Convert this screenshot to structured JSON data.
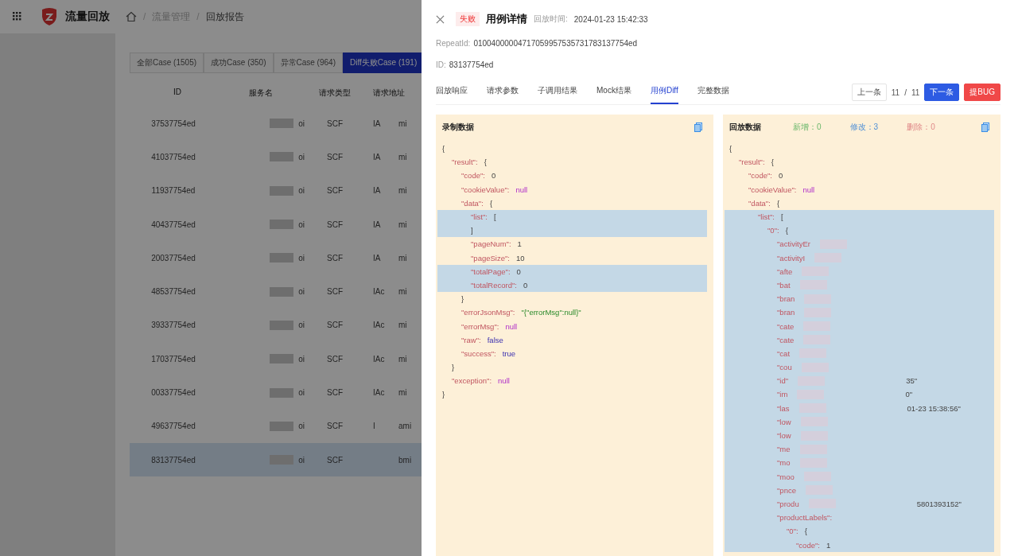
{
  "app": {
    "title": "流量回放",
    "breadcrumb": [
      "流量管理",
      "回放报告"
    ],
    "breadcrumb_separator": "/"
  },
  "case_tabs": [
    {
      "label": "全部Case (1505)",
      "selected": false
    },
    {
      "label": "成功Case (350)",
      "selected": false
    },
    {
      "label": "异常Case (964)",
      "selected": false
    },
    {
      "label": "Diff失败Case (191)",
      "selected": true
    }
  ],
  "table": {
    "columns": [
      "ID",
      "服务名",
      "请求类型",
      "请求地址"
    ],
    "rows": [
      {
        "id": "37537754ed",
        "service": "oi",
        "type": "SCF",
        "address": "IA",
        "column_5": "mi",
        "selected": false
      },
      {
        "id": "41037754ed",
        "service": "oi",
        "type": "SCF",
        "address": "IA",
        "column_5": "mi",
        "selected": false
      },
      {
        "id": "11937754ed",
        "service": "oi",
        "type": "SCF",
        "address": "IA",
        "column_5": "mi",
        "selected": false
      },
      {
        "id": "40437754ed",
        "service": "oi",
        "type": "SCF",
        "address": "IA",
        "column_5": "mi",
        "selected": false
      },
      {
        "id": "20037754ed",
        "service": "oi",
        "type": "SCF",
        "address": "IA",
        "column_5": "mi",
        "selected": false
      },
      {
        "id": "48537754ed",
        "service": "oi",
        "type": "SCF",
        "address": "IAc",
        "column_5": "mi",
        "selected": false
      },
      {
        "id": "39337754ed",
        "service": "oi",
        "type": "SCF",
        "address": "IAc",
        "column_5": "mi",
        "selected": false
      },
      {
        "id": "17037754ed",
        "service": "oi",
        "type": "SCF",
        "address": "IAc",
        "column_5": "mi",
        "selected": false
      },
      {
        "id": "00337754ed",
        "service": "oi",
        "type": "SCF",
        "address": "IAc",
        "column_5": "mi",
        "selected": false
      },
      {
        "id": "49637754ed",
        "service": "oi",
        "type": "SCF",
        "address": "I",
        "column_5": "ami",
        "selected": false
      },
      {
        "id": "83137754ed",
        "service": "oi",
        "type": "SCF",
        "address": "",
        "column_5": "bmi",
        "selected": true
      }
    ]
  },
  "drawer": {
    "status": "失败",
    "title": "用例详情",
    "time_label": "回放时间:",
    "time": "2024-01-23 15:42:33",
    "repeat_label": "RepeatId:",
    "repeat_id": "01004000004717059957535731783137754ed",
    "id_label": "ID:",
    "id": "83137754ed",
    "tabs": [
      {
        "label": "回放响应",
        "selected": false
      },
      {
        "label": "请求参数",
        "selected": false
      },
      {
        "label": "子调用结果",
        "selected": false
      },
      {
        "label": "Mock结果",
        "selected": false
      },
      {
        "label": "用例Diff",
        "selected": true
      },
      {
        "label": "完整数据",
        "selected": false
      }
    ],
    "pager": {
      "prev": "上一条",
      "current": "11",
      "separator": "/",
      "total": "11",
      "next": "下一条",
      "bug": "提BUG"
    },
    "panels": [
      {
        "title": "录制数据",
        "tree": {
          "kind": "object",
          "open": "{",
          "close": "}",
          "children": [
            {
              "key": "\"result\":",
              "kind": "object",
              "open": "{",
              "close": "}",
              "children": [
                {
                  "key": "\"code\":",
                  "kind": "number",
                  "value": "0"
                },
                {
                  "key": "\"cookieValue\":",
                  "kind": "null",
                  "value": "null"
                },
                {
                  "key": "\"data\":",
                  "kind": "object",
                  "open": "{",
                  "close": "}",
                  "children": [
                    {
                      "key": "\"list\":",
                      "kind": "object",
                      "open": "[",
                      "close": "]",
                      "changed": true
                    },
                    {
                      "key": "\"pageNum\":",
                      "kind": "number",
                      "value": "1"
                    },
                    {
                      "key": "\"pageSize\":",
                      "kind": "number",
                      "value": "10"
                    },
                    {
                      "key": "\"totalPage\":",
                      "kind": "number",
                      "value": "0",
                      "changed": true
                    },
                    {
                      "key": "\"totalRecord\":",
                      "kind": "number",
                      "value": "0",
                      "changed": true
                    }
                  ]
                },
                {
                  "key": "\"errorJsonMsg\":",
                  "kind": "string",
                  "value": "\"{\"errorMsg\":null}\""
                },
                {
                  "key": "\"errorMsg\":",
                  "kind": "null",
                  "value": "null"
                },
                {
                  "key": "\"raw\":",
                  "kind": "bool",
                  "value": "false"
                },
                {
                  "key": "\"success\":",
                  "kind": "bool",
                  "value": "true"
                }
              ]
            },
            {
              "key": "\"exception\":",
              "kind": "null",
              "value": "null"
            }
          ]
        }
      },
      {
        "title": "回放数据",
        "stats": [
          {
            "label": "新增：0",
            "kind": "added"
          },
          {
            "label": "修改：3",
            "kind": "modified"
          },
          {
            "label": "删除：0",
            "kind": "deleted"
          }
        ],
        "tree": {
          "kind": "object",
          "open": "{",
          "children": [
            {
              "key": "\"result\":",
              "kind": "object",
              "open": "{",
              "children": [
                {
                  "key": "\"code\":",
                  "kind": "number",
                  "value": "0"
                },
                {
                  "key": "\"cookieValue\":",
                  "kind": "null",
                  "value": "null"
                },
                {
                  "key": "\"data\":",
                  "kind": "object",
                  "open": "{",
                  "children": [
                    {
                      "key": "\"list\":",
                      "kind": "object",
                      "open": "[",
                      "changed": true,
                      "children": [
                        {
                          "key": "\"0\":",
                          "kind": "object",
                          "open": "{",
                          "children": [
                            {
                              "key": "\"activityEr",
                              "kind": "redacted"
                            },
                            {
                              "key": "\"activityI",
                              "kind": "redacted"
                            },
                            {
                              "key": "\"afte",
                              "kind": "redacted"
                            },
                            {
                              "key": "\"bat",
                              "kind": "redacted"
                            },
                            {
                              "key": "\"bran",
                              "kind": "redacted"
                            },
                            {
                              "key": "\"bran",
                              "kind": "redacted"
                            },
                            {
                              "key": "\"cate",
                              "kind": "redacted"
                            },
                            {
                              "key": "\"cate",
                              "kind": "redacted"
                            },
                            {
                              "key": "\"cat",
                              "kind": "redacted"
                            },
                            {
                              "key": "\"cou",
                              "kind": "redacted"
                            },
                            {
                              "key": "\"id\"",
                              "kind": "redacted",
                              "value": "35\""
                            },
                            {
                              "key": "\"im",
                              "kind": "redacted",
                              "value": "0\""
                            },
                            {
                              "key": "\"las",
                              "kind": "redacted",
                              "value": "01-23 15:38:56\""
                            },
                            {
                              "key": "\"low",
                              "kind": "redacted"
                            },
                            {
                              "key": "\"low",
                              "kind": "redacted"
                            },
                            {
                              "key": "\"me",
                              "kind": "redacted"
                            },
                            {
                              "key": "\"mo",
                              "kind": "redacted"
                            },
                            {
                              "key": "\"moo",
                              "kind": "redacted"
                            },
                            {
                              "key": "\"pnce",
                              "kind": "redacted"
                            },
                            {
                              "key": "\"produ",
                              "kind": "redacted",
                              "value": "5801393152\""
                            },
                            {
                              "key": "\"productLabels\":",
                              "kind": "object",
                              "children": [
                                {
                                  "key": "\"0\":",
                                  "kind": "object",
                                  "open": "{",
                                  "children": [
                                    {
                                      "key": "\"code\":",
                                      "kind": "number",
                                      "value": "1"
                                    }
                                  ]
                                }
                              ]
                            }
                          ]
                        }
                      ]
                    }
                  ]
                }
              ]
            }
          ]
        }
      }
    ]
  }
}
